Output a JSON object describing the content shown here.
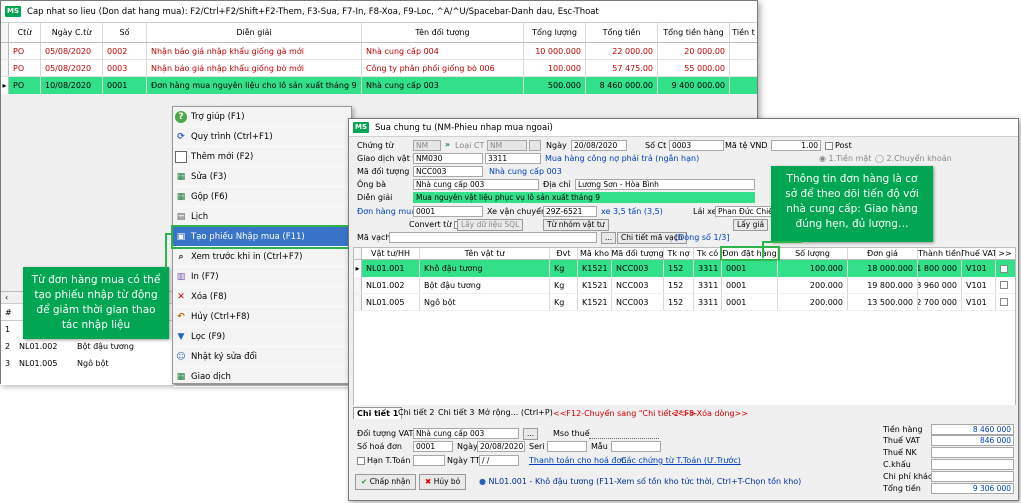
{
  "win1": {
    "title": "Cap nhat so lieu (Don dat hang mua): F2/Ctrl+F2/Shift+F2-Them, F3-Sua, F7-In, F8-Xoa, F9-Loc, ^A/^U/Spacebar-Danh dau, Esc-Thoat",
    "columns": [
      "Ctừ",
      "Ngày C.từ",
      "Số",
      "Diễn giải",
      "Tên đối tượng",
      "Tổng lượng",
      "Tổng tiền",
      "Tổng tiền hàng",
      "Tiền t"
    ],
    "rows": [
      [
        "PO",
        "05/08/2020",
        "0002",
        "Nhận báo giá nhập khẩu giống gà mới",
        "Nhà cung cấp 004",
        "10 000.000",
        "22 000.00",
        "20 000.00"
      ],
      [
        "PO",
        "05/08/2020",
        "0003",
        "Nhận báo giá nhập khẩu giống bò mới",
        "Công ty phân phối giống bò 006",
        "100.000",
        "57 475.00",
        "55 000.00"
      ],
      [
        "PO",
        "10/08/2020",
        "0001",
        "Đơn hàng mua nguyên liệu cho lô sản xuất tháng 9",
        "Nhà cung cấp 003",
        "500.000",
        "8 460 000.00",
        "9 400 000.00"
      ]
    ],
    "bottom_header": "#",
    "bottom_rows": [
      [
        "1",
        ""
      ],
      [
        "2",
        "NL01.002",
        "Bột đậu tương"
      ],
      [
        "3",
        "NL01.005",
        "Ngô bột"
      ]
    ]
  },
  "menu": [
    {
      "label": "Trợ giúp (F1)",
      "icon": "help-icon"
    },
    {
      "label": "Quy trình (Ctrl+F1)",
      "icon": "process-icon"
    },
    {
      "label": "Thêm mới (F2)",
      "icon": "add-icon"
    },
    {
      "label": "Sửa (F3)",
      "icon": "edit-icon"
    },
    {
      "label": "Gộp (F6)",
      "icon": "merge-icon"
    },
    {
      "label": "Lịch",
      "icon": "calendar-icon"
    },
    {
      "label": "Tạo phiếu Nhập mua (F11)",
      "icon": "receipt-icon"
    },
    {
      "label": "Xem trước khi in (Ctrl+F7)",
      "icon": "preview-icon"
    },
    {
      "label": "In (F7)",
      "icon": "print-icon"
    },
    {
      "label": "Xóa (F8)",
      "icon": "delete-icon"
    },
    {
      "label": "Hủy (Ctrl+F8)",
      "icon": "cancel-icon"
    },
    {
      "label": "Lọc (F9)",
      "icon": "filter-icon"
    },
    {
      "label": "Nhật ký sửa đổi",
      "icon": "log-icon"
    },
    {
      "label": "Giao dịch",
      "icon": "transaction-icon"
    }
  ],
  "callout_left": "Từ đơn hàng mua có thể tạo phiếu nhập từ động để giảm thời gian thao tác nhập liệu",
  "callout_right": "Thông tin đơn hàng là cơ sở để theo dõi tiến độ với nhà cung cấp: Giao hàng đúng hẹn, đủ lượng…",
  "win2": {
    "title": "Sua chung tu (NM-Phieu nhap mua ngoai)",
    "f": {
      "chung_tu_l": "Chứng từ",
      "chung_tu": "NM",
      "loai_ct_l": "Loại CT",
      "loai_ct": "NM",
      "ngay_l": "Ngày",
      "ngay": "20/08/2020",
      "so_ct_l": "Số Ct",
      "so_ct": "0003",
      "ma_te_l": "Mã tệ VND",
      "ty_gia": "1.00",
      "post_l": "Post",
      "gdvt_l": "Giao dịch vật tư",
      "gdvt": "NM030",
      "tk": "3311",
      "gdvt_desc": "Mua hàng công nợ phải trả (ngắn hạn)",
      "tien_mat": "1.Tiền mặt",
      "chuyen_khoan": "2.Chuyển khoản",
      "mdt_l": "Mã đối tượng",
      "mdt": "NCC003",
      "mdt_name": "Nhà cung cấp 003",
      "ong_ba_l": "Ông bà",
      "ong_ba": "Nhà cung cấp 003",
      "dia_chi_l": "Địa chỉ",
      "dia_chi": "Lương Sơn - Hòa Bình",
      "dien_giai_l": "Diễn giải",
      "dien_giai": "Mua nguyên vật liệu phục vụ lô sản xuất tháng 9",
      "dhm_l": "Đơn hàng mua",
      "dhm": "0001",
      "xvc_l": "Xe vận chuyển",
      "xvc": "29Z-6521",
      "xvc_desc": "xe 3,5 tấn (3,5)",
      "lai_xe_l": "Lái xe",
      "lai_xe": "Phan Đức Chiến",
      "convert_l": "Convert từ",
      "lay_du_lieu": "Lấy dữ liệu SQL",
      "tu_nhom": "Từ nhóm vật tư",
      "lay_gia": "Lấy giá",
      "ma_vach_l": "Mã vạch",
      "chi_tiet_ma_vach": "Chi tiết mã vạch",
      "dong_so": "[Dòng số 1/3]"
    },
    "columns": [
      "Vật tư/HH",
      "Tên vật tư",
      "Đvt",
      "Mã kho",
      "Mã đối tượng",
      "Tk nợ",
      "Tk có",
      "Đơn đặt hàng",
      "Số lượng",
      "Đơn giá",
      "Thành tiền",
      "Thuế VAT",
      ">>"
    ],
    "rows": [
      [
        "NL01.001",
        "Khô đậu tương",
        "Kg",
        "K1521",
        "NCC003",
        "152",
        "3311",
        "0001",
        "100.000",
        "18 000.000",
        "1 800 000",
        "V101"
      ],
      [
        "NL01.002",
        "Bột đậu tương",
        "Kg",
        "K1521",
        "NCC003",
        "152",
        "3311",
        "0001",
        "200.000",
        "19 800.000",
        "3 960 000",
        "V101"
      ],
      [
        "NL01.005",
        "Ngô bột",
        "Kg",
        "K1521",
        "NCC003",
        "152",
        "3311",
        "0001",
        "200.000",
        "13 500.000",
        "2 700 000",
        "V101"
      ]
    ],
    "tabs": [
      "Chi tiết 1",
      "Chi tiết 2",
      "Chi tiết 3",
      "Mở rộng... (Ctrl+P)"
    ],
    "hint_f12": "<<F12-Chuyển sang \"Chi tiết 2\">>",
    "hint_f8": "<<F8-Xóa dòng>>",
    "b": {
      "dt_vat_l": "Đối tượng VAT",
      "dt_vat": "Nhà cung cấp 003",
      "mso_thue_l": "Mso thuế",
      "so_hd_l": "Số hoá đơn",
      "so_hd": "0001",
      "ngay_hd_l": "Ngày",
      "ngay_hd": "20/08/2020",
      "seri_l": "Seri",
      "mau_l": "Mẫu",
      "han_tt_l": "Hạn T.Toán",
      "ngay_tt_l": "Ngày TT",
      "ngay_tt": "/  /",
      "thanh_toan": "Thanh toán cho hoá đơn",
      "cac_ct": "Các chứng từ T.Toán (Ư.Trước)"
    },
    "totals": [
      [
        "Tiền hàng",
        "8 460 000"
      ],
      [
        "Thuế VAT",
        "846 000"
      ],
      [
        "Thuế NK",
        ""
      ],
      [
        "C.khấu",
        ""
      ],
      [
        "Chi phí khác",
        ""
      ],
      [
        "Tổng tiền",
        "9 306 000"
      ]
    ],
    "accept": "Chấp nhận",
    "cancel": "Hủy bỏ",
    "status": "NL01.001 - Khô đậu tương   (F11-Xem số tồn kho tức thời, Ctrl+T-Chọn tồn kho)"
  }
}
